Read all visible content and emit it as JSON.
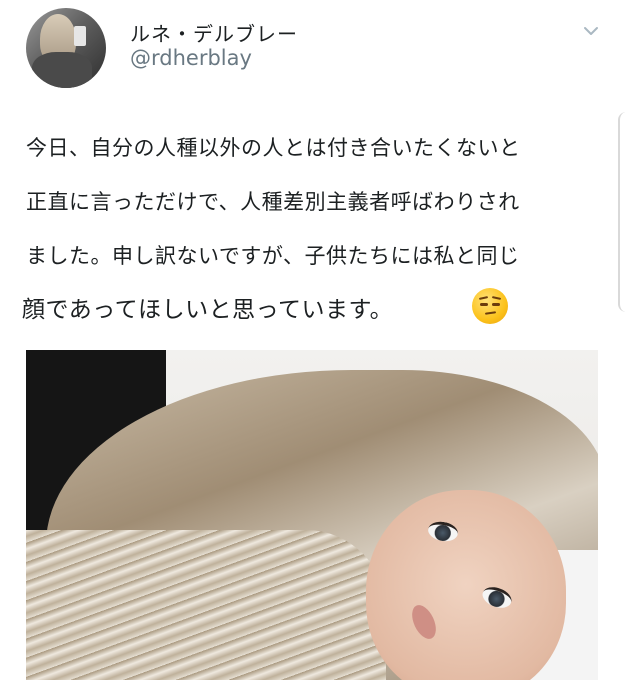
{
  "user": {
    "display_name": "ルネ・デルブレー",
    "handle": "@rdherblay"
  },
  "tweet": {
    "lines": [
      "今日、自分の人種以外の人とは付き合いたくないと",
      "正直に言っただけで、人種差別主義者呼ばわりされ",
      "ました。申し訳ないですが、子供たちには私と同じ",
      "顔であってほしいと思っています。"
    ],
    "emoji": "unamused-face-icon"
  },
  "icons": {
    "menu": "chevron-down-icon"
  },
  "colors": {
    "text": "#1c2022",
    "handle": "#697882",
    "chevron": "#aab8c2"
  }
}
